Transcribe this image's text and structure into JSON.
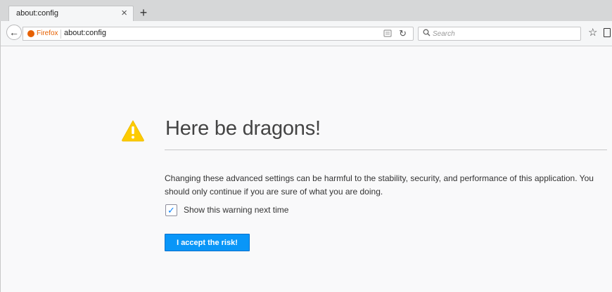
{
  "tab": {
    "title": "about:config",
    "close_glyph": "×"
  },
  "new_tab_glyph": "+",
  "navbar": {
    "back_glyph": "←",
    "identity_label": "Firefox",
    "url": "about:config",
    "reload_glyph": "↻",
    "search_placeholder": "Search",
    "search_value": "",
    "bookmark_glyph": "☆"
  },
  "page": {
    "heading": "Here be dragons!",
    "description": "Changing these advanced settings can be harmful to the stability, security, and performance of this application. You should only continue if you are sure of what you are doing.",
    "checkbox_label": "Show this warning next time",
    "checkbox_checked": true,
    "checkbox_glyph": "✓",
    "accept_button": "I accept the risk!"
  },
  "colors": {
    "accent_blue": "#0996f8",
    "warning_yellow": "#fdcb00",
    "firefox_orange": "#e66000"
  },
  "icons": [
    "back-arrow-icon",
    "firefox-icon",
    "reader-view-icon",
    "reload-icon",
    "search-icon",
    "bookmark-star-icon",
    "clipboard-icon",
    "warning-triangle-icon",
    "tab-close-icon",
    "new-tab-icon"
  ]
}
